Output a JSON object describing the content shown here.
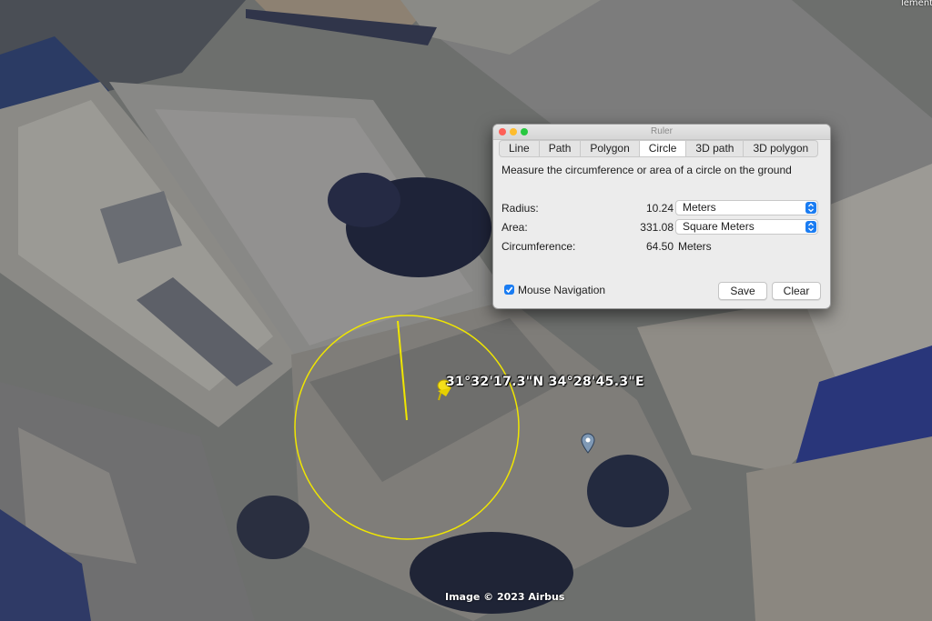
{
  "map": {
    "coordinate_label": "31°32'17.3\"N 34°28'45.3\"E",
    "copyright": "Image © 2023 Airbus",
    "corner_text": "lementa",
    "circle_color": "#f0e600"
  },
  "ruler": {
    "window_title": "Ruler",
    "tabs": [
      {
        "label": "Line"
      },
      {
        "label": "Path"
      },
      {
        "label": "Polygon"
      },
      {
        "label": "Circle",
        "active": true
      },
      {
        "label": "3D path"
      },
      {
        "label": "3D polygon"
      }
    ],
    "description": "Measure the circumference or area of a circle on the ground",
    "radius": {
      "label": "Radius:",
      "value": "10.24",
      "unit": "Meters"
    },
    "area": {
      "label": "Area:",
      "value": "331.08",
      "unit": "Square Meters"
    },
    "circumference": {
      "label": "Circumference:",
      "value": "64.50",
      "unit": "Meters"
    },
    "mouse_navigation": {
      "label": "Mouse Navigation",
      "checked": true
    },
    "buttons": {
      "save": "Save",
      "clear": "Clear"
    },
    "accent_color": "#1a7cf2"
  }
}
